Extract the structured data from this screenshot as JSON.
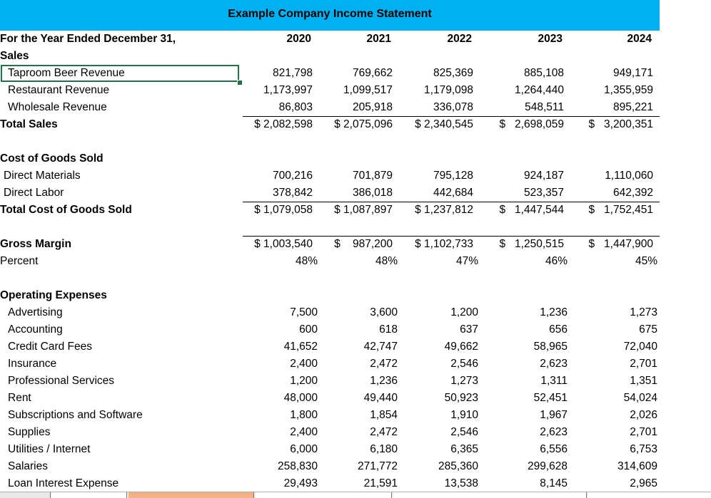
{
  "title": "Example Company Income Statement",
  "period_label": "For the Year Ended December 31,",
  "years": [
    "2020",
    "2021",
    "2022",
    "2023",
    "2024"
  ],
  "sections": {
    "sales": {
      "label": "Sales",
      "rows": [
        {
          "label": "Taproom Beer Revenue",
          "values": [
            "821,798",
            "769,662",
            "825,369",
            "885,108",
            "949,171"
          ]
        },
        {
          "label": "Restaurant Revenue",
          "values": [
            "1,173,997",
            "1,099,517",
            "1,179,098",
            "1,264,440",
            "1,355,959"
          ]
        },
        {
          "label": "Wholesale Revenue",
          "values": [
            "86,803",
            "205,918",
            "336,078",
            "548,511",
            "895,221"
          ]
        }
      ],
      "total": {
        "label": "Total Sales",
        "values": [
          "$ 2,082,598",
          "$ 2,075,096",
          "$ 2,340,545",
          "$   2,698,059",
          "$   3,200,351"
        ]
      }
    },
    "cogs": {
      "label": "Cost of Goods Sold",
      "rows": [
        {
          "label": "Direct Materials",
          "values": [
            "700,216",
            "701,879",
            "795,128",
            "924,187",
            "1,110,060"
          ]
        },
        {
          "label": "Direct Labor",
          "values": [
            "378,842",
            "386,018",
            "442,684",
            "523,357",
            "642,392"
          ]
        }
      ],
      "total": {
        "label": "Total Cost of Goods Sold",
        "values": [
          "$ 1,079,058",
          "$ 1,087,897",
          "$ 1,237,812",
          "$   1,447,544",
          "$   1,752,451"
        ]
      }
    },
    "gross": {
      "label": "Gross Margin",
      "values": [
        "$ 1,003,540",
        "$    987,200",
        "$ 1,102,733",
        "$   1,250,515",
        "$   1,447,900"
      ],
      "percent_label": "Percent",
      "percent_values": [
        "48%",
        "48%",
        "47%",
        "46%",
        "45%"
      ]
    },
    "opex": {
      "label": "Operating Expenses",
      "rows": [
        {
          "label": "Advertising",
          "values": [
            "7,500",
            "3,600",
            "1,200",
            "1,236",
            "1,273"
          ]
        },
        {
          "label": "Accounting",
          "values": [
            "600",
            "618",
            "637",
            "656",
            "675"
          ]
        },
        {
          "label": "Credit Card Fees",
          "values": [
            "41,652",
            "42,747",
            "49,662",
            "58,965",
            "72,040"
          ]
        },
        {
          "label": "Insurance",
          "values": [
            "2,400",
            "2,472",
            "2,546",
            "2,623",
            "2,701"
          ]
        },
        {
          "label": "Professional Services",
          "values": [
            "1,200",
            "1,236",
            "1,273",
            "1,311",
            "1,351"
          ]
        },
        {
          "label": "Rent",
          "values": [
            "48,000",
            "49,440",
            "50,923",
            "52,451",
            "54,024"
          ]
        },
        {
          "label": "Subscriptions and Software",
          "values": [
            "1,800",
            "1,854",
            "1,910",
            "1,967",
            "2,026"
          ]
        },
        {
          "label": "Supplies",
          "values": [
            "2,400",
            "2,472",
            "2,546",
            "2,623",
            "2,701"
          ]
        },
        {
          "label": "Utilities / Internet",
          "values": [
            "6,000",
            "6,180",
            "6,365",
            "6,556",
            "6,753"
          ]
        },
        {
          "label": "Salaries",
          "values": [
            "258,830",
            "271,772",
            "285,360",
            "299,628",
            "314,609"
          ]
        },
        {
          "label": "Loan Interest Expense",
          "values": [
            "29,493",
            "21,591",
            "13,538",
            "8,145",
            "2,965"
          ]
        }
      ]
    }
  },
  "colors": {
    "title_fill": "#00b0f0",
    "selection": "#217346"
  }
}
